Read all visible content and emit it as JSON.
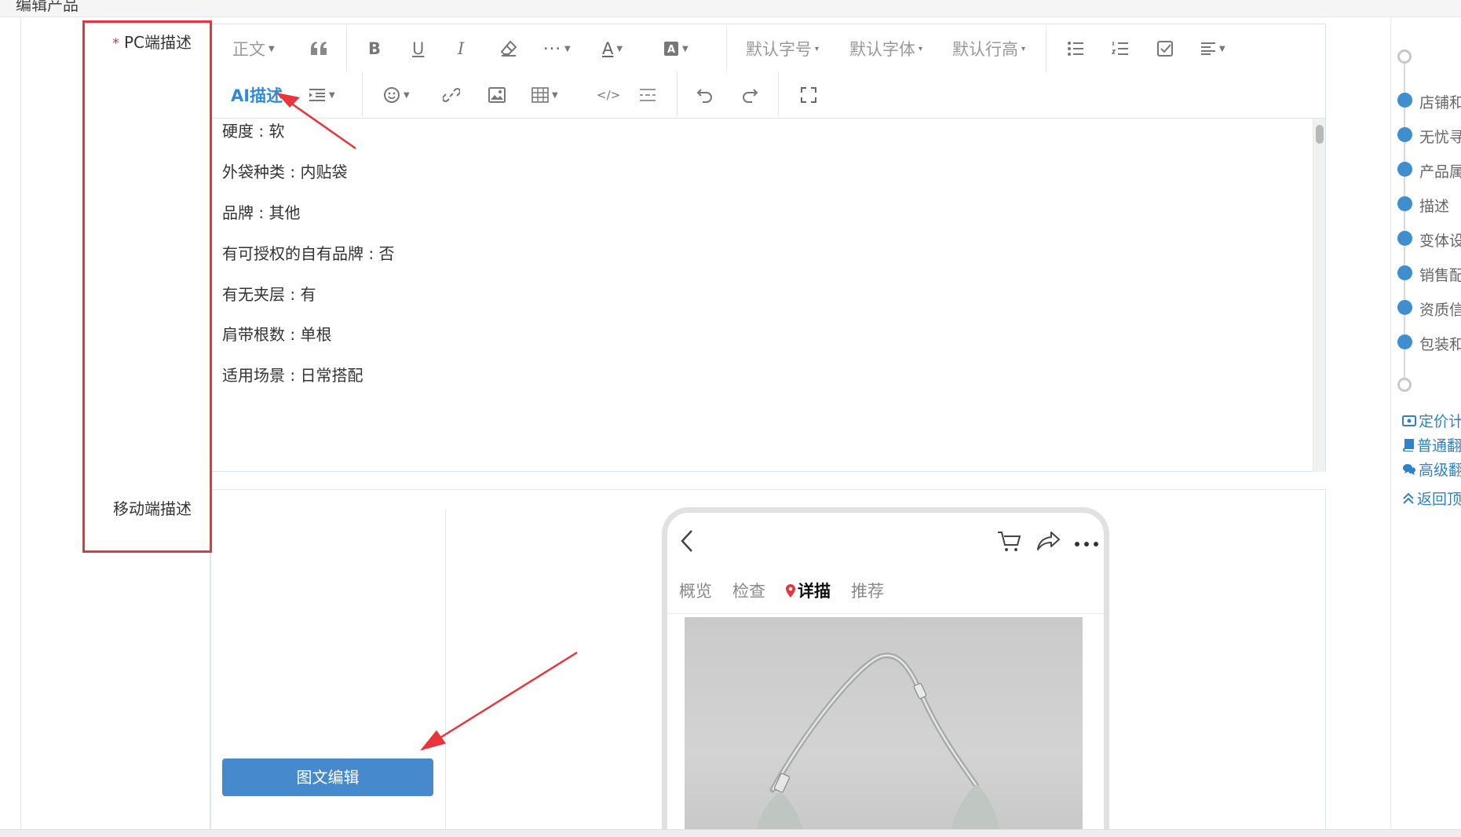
{
  "top_strip": {
    "text": "编辑产品"
  },
  "form": {
    "pc_label": "PC端描述",
    "required_mark": "*",
    "mobile_label": "移动端描述"
  },
  "toolbar": {
    "paragraph": "正文",
    "font_size": "默认字号",
    "font_family": "默认字体",
    "line_height": "默认行高",
    "ai_button": "AI描述"
  },
  "content_lines": [
    "硬度 : 软",
    "外袋种类 : 内贴袋",
    "品牌 : 其他",
    "有可授权的自有品牌 : 否",
    "有无夹层 : 有",
    "肩带根数 : 单根",
    "适用场景 : 日常搭配"
  ],
  "mobile": {
    "edit_button": "图文编辑",
    "tabs": [
      "概览",
      "检查",
      "详描",
      "推荐"
    ],
    "active_tab": 2
  },
  "right_nav": {
    "items": [
      "店铺和",
      "无忧寻",
      "产品属",
      "描述",
      "变体设",
      "销售配",
      "资质信",
      "包装和"
    ],
    "links": [
      "定价计",
      "普通翻",
      "高级翻",
      "返回顶"
    ]
  },
  "colors": {
    "accent": "#3f8ecf",
    "annotation_red": "#e8343a",
    "button_blue": "#4689cc"
  }
}
